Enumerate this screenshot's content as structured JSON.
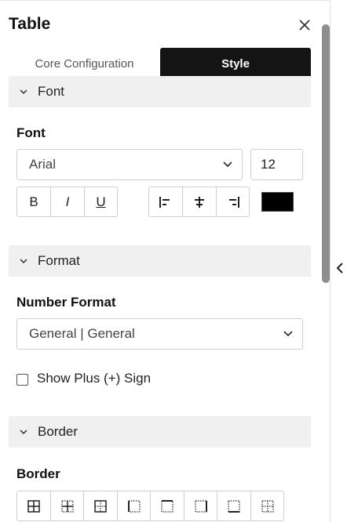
{
  "panel": {
    "title": "Table"
  },
  "tabs": [
    {
      "label": "Core Configuration",
      "active": false
    },
    {
      "label": "Style",
      "active": true
    }
  ],
  "sections": {
    "font": {
      "header": "Font",
      "field_label": "Font",
      "family_value": "Arial",
      "size_value": "12",
      "bold_label": "B",
      "italic_label": "I",
      "underline_label": "U",
      "alignment": [
        "align-left-icon",
        "align-center-icon",
        "align-right-icon"
      ],
      "color": "#000000"
    },
    "format": {
      "header": "Format",
      "field_label": "Number Format",
      "number_format_value": "General | General",
      "show_plus_label": "Show Plus (+) Sign",
      "show_plus_checked": false
    },
    "border": {
      "header": "Border",
      "field_label": "Border",
      "options": [
        "all-borders-icon",
        "inner-borders-icon",
        "outer-border-icon",
        "left-border-icon",
        "top-border-icon",
        "right-border-icon",
        "bottom-border-icon",
        "no-border-icon"
      ]
    }
  },
  "colors": {
    "active_tab": "#141414",
    "section_header": "#f0f0f0",
    "scrollbar": "#8e8e8e"
  }
}
